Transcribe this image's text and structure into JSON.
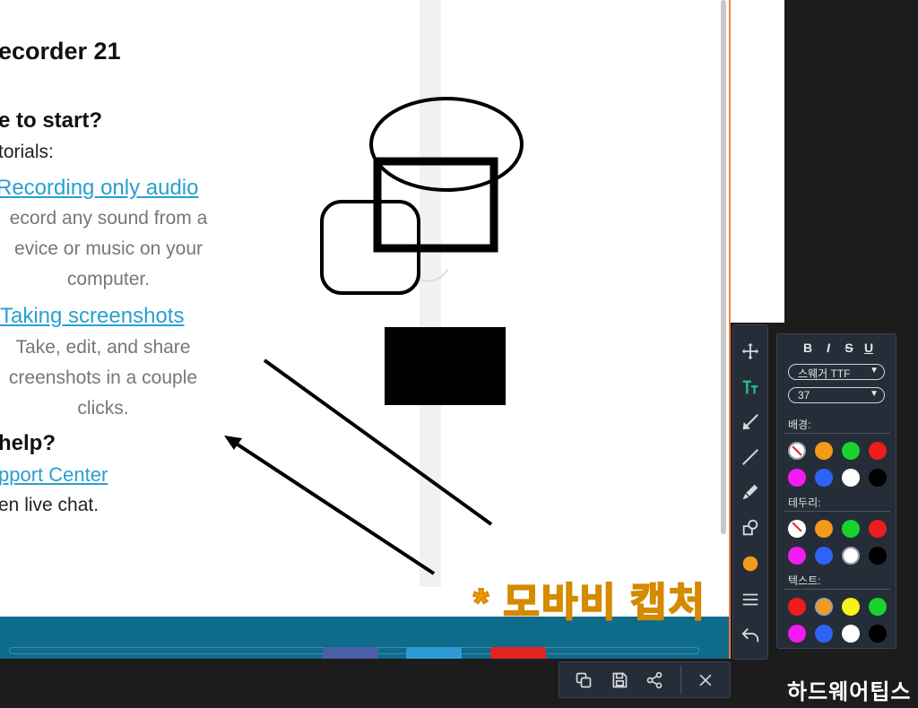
{
  "page": {
    "heading": "ecorder 21",
    "start_heading": "e to start?",
    "tutorials_label": "torials:",
    "tutorials": [
      {
        "title": "Recording only audio",
        "desc": [
          "ecord any sound from a",
          "evice or music on your",
          "computer."
        ]
      },
      {
        "title": "Taking screenshots",
        "desc": [
          "Take, edit, and share",
          "creenshots in a couple",
          "clicks."
        ]
      }
    ],
    "help_heading": "help?",
    "support_link": "pport Center",
    "live_chat": "en live chat."
  },
  "footer": {
    "button_colors": [
      "#4a5fa8",
      "#2f9bd6",
      "#e02424"
    ]
  },
  "watermark": "* 모바비 캡처",
  "tools": [
    {
      "name": "move-tool",
      "icon": "move-icon",
      "active": false
    },
    {
      "name": "text-tool",
      "icon": "text-icon",
      "active": true
    },
    {
      "name": "arrow-tool",
      "icon": "arrow-icon",
      "active": false
    },
    {
      "name": "line-tool",
      "icon": "line-icon",
      "active": false
    },
    {
      "name": "marker-tool",
      "icon": "marker-icon",
      "active": false
    },
    {
      "name": "shapes-tool",
      "icon": "shapes-icon",
      "active": false
    },
    {
      "name": "color-tool",
      "icon": "color-circle-icon",
      "color": "#f29a1a",
      "active": false
    },
    {
      "name": "line-weight-tool",
      "icon": "line-weight-icon",
      "active": false
    },
    {
      "name": "undo-tool",
      "icon": "undo-icon",
      "active": false
    }
  ],
  "text_panel": {
    "format": {
      "bold": "B",
      "italic": "I",
      "strike": "S",
      "underline": "U"
    },
    "font_family": "스웨거 TTF",
    "font_size": "37",
    "background_label": "배경:",
    "border_label": "테두리:",
    "text_label": "텍스트:",
    "background_colors": [
      "none",
      "#f29a1a",
      "#19d22e",
      "#ee1c1c",
      "#f21cf2",
      "#2f63f5",
      "#ffffff",
      "#000000"
    ],
    "border_colors": [
      "none",
      "#f29a1a",
      "#19d22e",
      "#ee1c1c",
      "#f21cf2",
      "#2f63f5",
      "#ffffff",
      "#000000"
    ],
    "text_colors": [
      "#ee1c1c",
      "#f29a1a",
      "#f7f21a",
      "#19d22e",
      "#f21cf2",
      "#2f63f5",
      "#ffffff",
      "#000000"
    ],
    "selected_background": 0,
    "selected_border": 6,
    "selected_text": 1
  },
  "actions": [
    {
      "name": "copy-button",
      "icon": "copy-icon"
    },
    {
      "name": "save-button",
      "icon": "save-icon"
    },
    {
      "name": "share-button",
      "icon": "share-icon"
    },
    {
      "name": "close-button",
      "icon": "close-icon"
    }
  ],
  "brand": "하드웨어팁스"
}
